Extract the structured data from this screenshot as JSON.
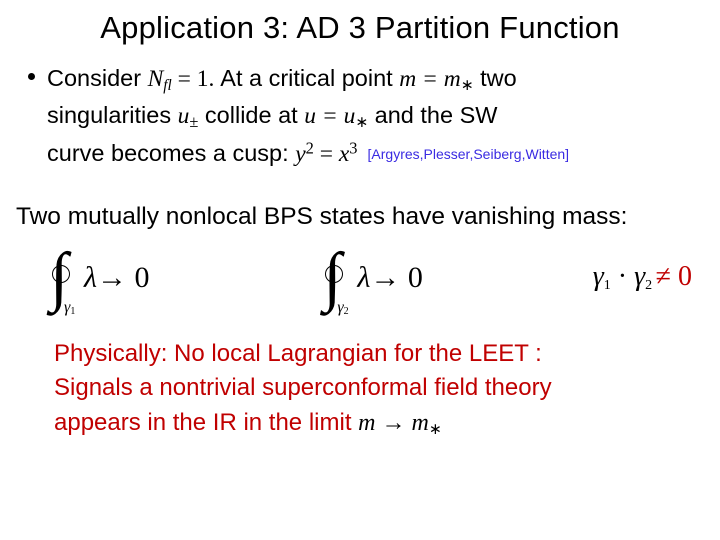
{
  "title": "Application 3: AD 3 Partition Function",
  "bullet": {
    "lead": "Consider ",
    "nfl_var": "N",
    "nfl_sub": "fl",
    "nfl_eq": " = 1.   ",
    "part2": "At a critical point ",
    "m_eq_mstar": "m = m",
    "star_sub": "∗",
    "part3": "  two",
    "line2a": "singularities ",
    "u_var": "u",
    "u_pm": "±",
    "line2b": " collide at ",
    "u_eq_ustar": "u = u",
    "line2c": " and the SW",
    "line3a": "curve becomes a cusp:  ",
    "cusp_y": "y",
    "cusp_y_exp": "2",
    "cusp_eq": " = ",
    "cusp_x": "x",
    "cusp_x_exp": "3",
    "citation": "[Argyres,Plesser,Seiberg,Witten]"
  },
  "mid_line": "Two mutually nonlocal BPS states have vanishing mass:",
  "eq": {
    "gamma1_sub": "γ",
    "gamma1_n": "1",
    "lambda": "λ",
    "to0": " → 0",
    "gamma2_sub": "γ",
    "gamma2_n": "2",
    "int_g1": "γ",
    "int_n1": "1",
    "int_dot": " · ",
    "int_g2": "γ",
    "int_n2": "2 ",
    "int_ne": " ≠ 0"
  },
  "red": {
    "l1": "Physically: No local Lagrangian for the LEET :",
    "l2": "Signals a nontrivial superconformal field theory",
    "l3a": "appears in the IR in the limit  ",
    "m": "m",
    "arrow": " → ",
    "m2": "m",
    "star": "∗"
  }
}
